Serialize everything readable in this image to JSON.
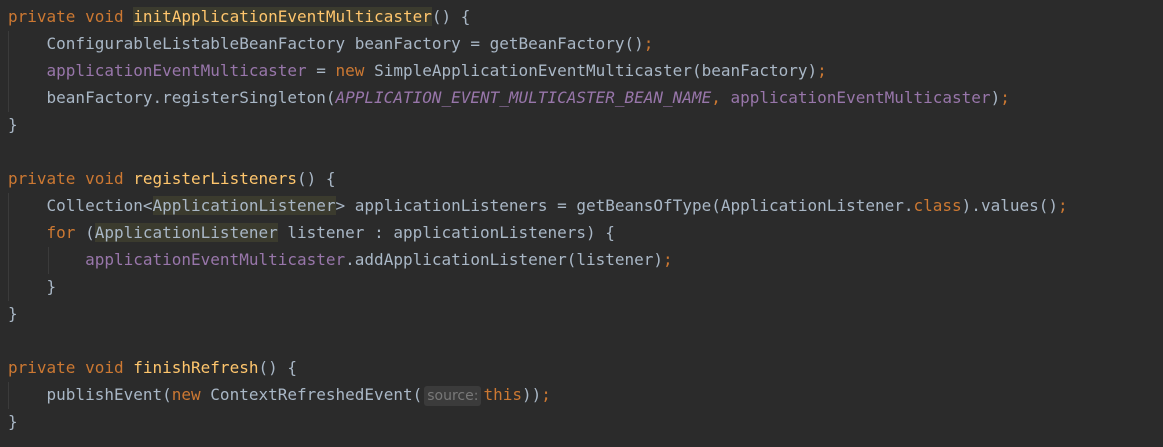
{
  "editor": {
    "lines": [
      [
        {
          "t": "private void ",
          "c": "t-kw"
        },
        {
          "t": "initApplicationEventMulticaster",
          "c": "t-fn hl-fn"
        },
        {
          "t": "() {",
          "c": "t-plain"
        }
      ],
      [
        {
          "t": "    ConfigurableListableBeanFactory beanFactory = getBeanFactory()",
          "c": "t-plain"
        },
        {
          "t": ";",
          "c": "t-kw"
        }
      ],
      [
        {
          "t": "    ",
          "c": "t-plain"
        },
        {
          "t": "applicationEventMulticaster",
          "c": "t-field"
        },
        {
          "t": " = ",
          "c": "t-plain"
        },
        {
          "t": "new ",
          "c": "t-kw"
        },
        {
          "t": "SimpleApplicationEventMulticaster(beanFactory)",
          "c": "t-plain"
        },
        {
          "t": ";",
          "c": "t-kw"
        }
      ],
      [
        {
          "t": "    beanFactory.registerSingleton(",
          "c": "t-plain"
        },
        {
          "t": "APPLICATION_EVENT_MULTICASTER_BEAN_NAME",
          "c": "t-const"
        },
        {
          "t": ", ",
          "c": "t-kw"
        },
        {
          "t": "applicationEventMulticaster",
          "c": "t-field"
        },
        {
          "t": ")",
          "c": "t-plain"
        },
        {
          "t": ";",
          "c": "t-kw"
        }
      ],
      [
        {
          "t": "}",
          "c": "t-plain"
        }
      ],
      [],
      [
        {
          "t": "private void ",
          "c": "t-kw"
        },
        {
          "t": "registerListeners",
          "c": "t-fn"
        },
        {
          "t": "() {",
          "c": "t-plain"
        }
      ],
      [
        {
          "t": "    Collection<",
          "c": "t-plain"
        },
        {
          "t": "ApplicationListener",
          "c": "t-plain hl"
        },
        {
          "t": "> applicationListeners = getBeansOfType(ApplicationListener.",
          "c": "t-plain"
        },
        {
          "t": "class",
          "c": "t-kw"
        },
        {
          "t": ").values()",
          "c": "t-plain"
        },
        {
          "t": ";",
          "c": "t-kw"
        }
      ],
      [
        {
          "t": "    ",
          "c": "t-plain"
        },
        {
          "t": "for ",
          "c": "t-kw"
        },
        {
          "t": "(",
          "c": "t-plain"
        },
        {
          "t": "ApplicationListener",
          "c": "t-plain hl"
        },
        {
          "t": " listener : applicationListeners) {",
          "c": "t-plain"
        }
      ],
      [
        {
          "t": "        ",
          "c": "t-plain"
        },
        {
          "t": "applicationEventMulticaster",
          "c": "t-field"
        },
        {
          "t": ".addApplicationListener(listener)",
          "c": "t-plain"
        },
        {
          "t": ";",
          "c": "t-kw"
        }
      ],
      [
        {
          "t": "    }",
          "c": "t-plain"
        }
      ],
      [
        {
          "t": "}",
          "c": "t-plain"
        }
      ],
      [],
      [
        {
          "t": "private void ",
          "c": "t-kw"
        },
        {
          "t": "finishRefresh",
          "c": "t-fn"
        },
        {
          "t": "() {",
          "c": "t-plain"
        }
      ],
      [
        {
          "t": "    publishEvent(",
          "c": "t-plain"
        },
        {
          "t": "new ",
          "c": "t-kw"
        },
        {
          "t": "ContextRefreshedEvent(",
          "c": "t-plain"
        },
        {
          "t": "source:",
          "c": "hint"
        },
        {
          "t": "this",
          "c": "t-kw"
        },
        {
          "t": "))",
          "c": "t-plain"
        },
        {
          "t": ";",
          "c": "t-kw"
        }
      ],
      [
        {
          "t": "}",
          "c": "t-plain"
        }
      ]
    ]
  }
}
